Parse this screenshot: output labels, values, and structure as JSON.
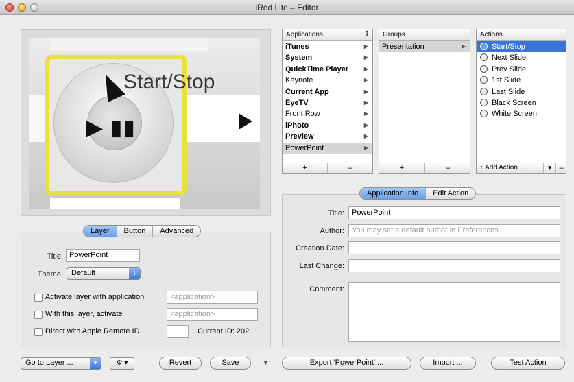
{
  "window": {
    "title": "iRed Lite – Editor"
  },
  "preview": {
    "label": "Start/Stop"
  },
  "applications": {
    "header": "Applications",
    "items": [
      {
        "label": "iTunes",
        "bold": true,
        "selected": false
      },
      {
        "label": "System",
        "bold": true,
        "selected": false
      },
      {
        "label": "QuickTime Player",
        "bold": true,
        "selected": false
      },
      {
        "label": "Keynote",
        "bold": false,
        "selected": false
      },
      {
        "label": "Current App",
        "bold": true,
        "selected": false
      },
      {
        "label": "EyeTV",
        "bold": true,
        "selected": false
      },
      {
        "label": "Front Row",
        "bold": false,
        "selected": false
      },
      {
        "label": "iPhoto",
        "bold": true,
        "selected": false
      },
      {
        "label": "Preview",
        "bold": true,
        "selected": false
      },
      {
        "label": "PowerPoint",
        "bold": false,
        "selected": true
      }
    ],
    "add_label": "+",
    "remove_label": "–"
  },
  "groups": {
    "header": "Groups",
    "items": [
      {
        "label": "Presentation",
        "selected": true
      }
    ],
    "add_label": "+",
    "remove_label": "–"
  },
  "actions": {
    "header": "Actions",
    "items": [
      {
        "label": "Start/Stop",
        "selected": true
      },
      {
        "label": "Next Slide",
        "selected": false
      },
      {
        "label": "Prev Slide",
        "selected": false
      },
      {
        "label": "1st Slide",
        "selected": false
      },
      {
        "label": "Last Slide",
        "selected": false
      },
      {
        "label": "Black Screen",
        "selected": false
      },
      {
        "label": "White Screen",
        "selected": false
      }
    ],
    "add_action_label": "+ Add Action ...",
    "menu_label": "▾",
    "remove_label": "–"
  },
  "layer_tabs": {
    "layer": "Layer",
    "button": "Button",
    "advanced": "Advanced",
    "active": "Layer"
  },
  "layer_form": {
    "title_label": "Title:",
    "title_value": "PowerPoint",
    "theme_label": "Theme:",
    "theme_value": "Default",
    "activate_with_app_label": "Activate layer with application",
    "activate_with_app_placeholder": "<application>",
    "with_layer_activate_label": "With this layer, activate",
    "with_layer_activate_placeholder": "<application>",
    "remote_id_label": "Direct with Apple Remote ID",
    "current_id_label": "Current ID: 202"
  },
  "info_tabs": {
    "app_info": "Application Info",
    "edit_action": "Edit Action",
    "active": "Application Info"
  },
  "info_form": {
    "title_label": "Title:",
    "title_value": "PowerPoint",
    "author_label": "Author:",
    "author_placeholder": "You may set a default author in Preferences",
    "creation_label": "Creation Date:",
    "last_change_label": "Last Change:",
    "comment_label": "Comment:"
  },
  "bottom_bar": {
    "go_to_layer": "Go to Layer ...",
    "gear_menu": "⚙ ▾",
    "revert": "Revert",
    "save": "Save",
    "save_menu": "▼",
    "export": "Export 'PowerPoint' ...",
    "import": "Import ...",
    "test_action": "Test Action"
  }
}
